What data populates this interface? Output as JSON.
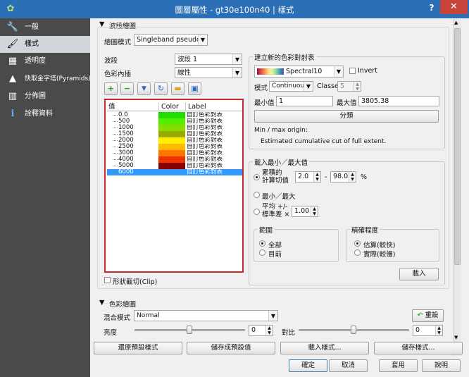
{
  "window": {
    "title": "圖層屬性 - gt30e100n40 | 樣式",
    "help": "?",
    "close": "✕"
  },
  "sidebar": {
    "items": [
      {
        "label": "一般",
        "icon": "wrench-icon",
        "glyph": "🔧"
      },
      {
        "label": "樣式",
        "icon": "brush-icon",
        "glyph": "🖌"
      },
      {
        "label": "透明度",
        "icon": "transparency-icon",
        "glyph": "▦"
      },
      {
        "label": "快取金字塔(Pyramids)",
        "icon": "pyramid-icon",
        "glyph": "▲"
      },
      {
        "label": "分佈圖",
        "icon": "histogram-icon",
        "glyph": "▥"
      },
      {
        "label": "詮釋資料",
        "icon": "info-icon",
        "glyph": "ℹ"
      }
    ]
  },
  "band_render": {
    "section_title": "波段繪圖",
    "render_type_label": "繪圖模式",
    "render_type_value": "Singleband pseudocolor",
    "band_label": "波段",
    "band_value": "波段 1",
    "interp_label": "色彩內插",
    "interp_value": "線性",
    "toolbar": [
      {
        "icon": "add-icon",
        "glyph": "+"
      },
      {
        "icon": "remove-icon",
        "glyph": "−"
      },
      {
        "icon": "load-icon",
        "glyph": "▼"
      },
      {
        "icon": "refresh-icon",
        "glyph": "↻"
      },
      {
        "icon": "open-folder-icon",
        "glyph": "▬"
      },
      {
        "icon": "save-icon",
        "glyph": "▣"
      }
    ],
    "table": {
      "headers": [
        "值",
        "Color",
        "Label"
      ],
      "rows": [
        {
          "value": "0.0",
          "color": "#22dd00",
          "label": "自訂色彩對表"
        },
        {
          "value": "500",
          "color": "#55ee00",
          "label": "自訂色彩對表"
        },
        {
          "value": "1000",
          "color": "#88dd00",
          "label": "自訂色彩對表"
        },
        {
          "value": "1500",
          "color": "#99aa00",
          "label": "自訂色彩對表"
        },
        {
          "value": "2000",
          "color": "#ffee00",
          "label": "自訂色彩對表"
        },
        {
          "value": "2500",
          "color": "#ffbb00",
          "label": "自訂色彩對表"
        },
        {
          "value": "3000",
          "color": "#ff7700",
          "label": "自訂色彩對表"
        },
        {
          "value": "4000",
          "color": "#ee3300",
          "label": "自訂色彩對表"
        },
        {
          "value": "5000",
          "color": "#880000",
          "label": "自訂色彩對表"
        },
        {
          "value": "6000",
          "color": "#3399ff",
          "label": "自訂色彩對表"
        }
      ]
    },
    "clip_label": "形狀截切(Clip)"
  },
  "new_ramp": {
    "title": "建立新的色彩對射表",
    "ramp_value": "Spectral10",
    "invert_label": "Invert",
    "mode_label": "模式",
    "mode_value": "Continuous",
    "classes_label": "Classes",
    "classes_value": "5",
    "min_label": "最小值",
    "min_value": "1",
    "max_label": "最大值",
    "max_value": "3805.38",
    "classify_button": "分類",
    "origin_label": "Min / max origin:",
    "origin_text": "Estimated cumulative cut of full extent."
  },
  "load_minmax": {
    "title": "載入最小／最大值",
    "cumulative_label_1": "累積的",
    "cumulative_label_2": "計算切值",
    "cum_low": "2.0",
    "dash": "-",
    "cum_high": "98.0",
    "percent": "%",
    "minmax_label": "最小／最大",
    "stddev_label_1": "平均 +/-",
    "stddev_label_2": "標準差 ×",
    "stddev_value": "1.00",
    "extent_title": "範圍",
    "extent_full": "全部",
    "extent_current": "目前",
    "accuracy_title": "精確程度",
    "accuracy_estimate": "估算(較快)",
    "accuracy_actual": "實際(較慢)",
    "load_button": "載入"
  },
  "color_render": {
    "section_title": "色彩繪圖",
    "blend_label": "混合模式",
    "blend_value": "Normal",
    "reset_button": "重設",
    "brightness_label": "亮度",
    "brightness_value": "0",
    "contrast_label": "對比",
    "contrast_value": "0"
  },
  "style_buttons": {
    "restore": "還原預設樣式",
    "save_default": "儲存成預設值",
    "load_style": "載入樣式...",
    "save_style": "儲存樣式..."
  },
  "dialog_buttons": {
    "ok": "確定",
    "cancel": "取消",
    "apply": "套用",
    "help": "說明"
  }
}
